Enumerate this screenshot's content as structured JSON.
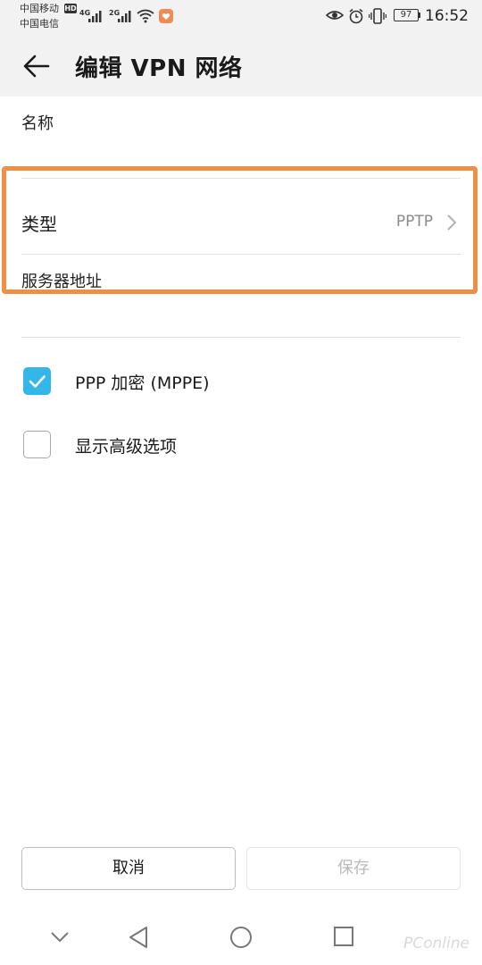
{
  "status_bar": {
    "carrier1": "中国移动",
    "carrier2": "中国电信",
    "hd_badge": "HD",
    "net1": "4G",
    "net2": "2G",
    "battery": "97",
    "time": "16:52",
    "icons": [
      "signal-icon",
      "wifi-icon",
      "notification-icon",
      "eye-icon",
      "alarm-icon",
      "vibrate-icon",
      "battery-icon"
    ]
  },
  "header": {
    "title": "编辑 VPN 网络",
    "back_icon": "arrow-left-icon"
  },
  "form": {
    "name_label": "名称",
    "name_value": "",
    "type_label": "类型",
    "type_value": "PPTP",
    "server_label": "服务器地址",
    "server_value": ""
  },
  "options": {
    "ppp_encryption": {
      "label": "PPP 加密 (MPPE)",
      "checked": true
    },
    "show_advanced": {
      "label": "显示高级选项",
      "checked": false
    }
  },
  "buttons": {
    "cancel": "取消",
    "save": "保存"
  },
  "nav": {
    "icons": [
      "chevron-down-icon",
      "back-triangle-icon",
      "home-circle-icon",
      "recents-square-icon"
    ]
  },
  "watermark": "PConline",
  "colors": {
    "accent": "#35b6e8",
    "highlight": "#ef8f45",
    "header_bg": "#f2f2f2"
  }
}
